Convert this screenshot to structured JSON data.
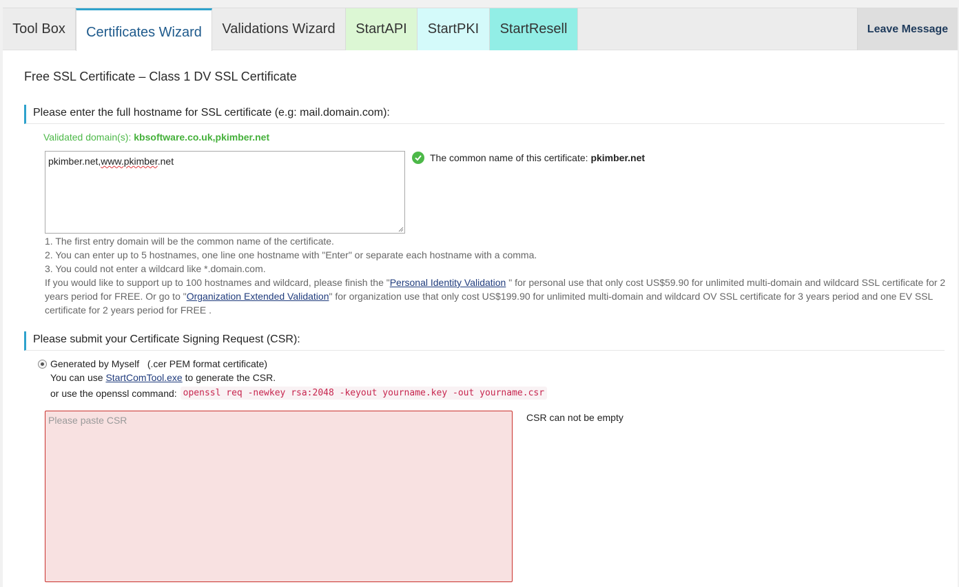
{
  "tabs": [
    {
      "label": "Tool Box"
    },
    {
      "label": "Certificates Wizard"
    },
    {
      "label": "Validations Wizard"
    },
    {
      "label": "StartAPI"
    },
    {
      "label": "StartPKI"
    },
    {
      "label": "StartResell"
    }
  ],
  "leave_message": "Leave Message",
  "page_title": "Free SSL Certificate – Class 1 DV SSL Certificate",
  "hostname_section": {
    "heading": "Please enter the full hostname for SSL certificate (e.g: mail.domain.com):",
    "validated_label": "Validated domain(s):",
    "validated_domains": "kbsoftware.co.uk,pkimber.net",
    "hostnames_part1": "pkimber.net,",
    "hostnames_part2": "www.pkimber",
    "hostnames_part3": ".net",
    "common_name_label": "The common name of this certificate:",
    "common_name_value": "pkimber.net",
    "note1": "1. The first entry domain will be the common name of the certificate.",
    "note2": "2. You can enter up to 5 hostnames, one line one hostname with \"Enter\" or separate each hostname with a comma.",
    "note3": "3. You could not enter a wildcard like *.domain.com.",
    "note4_a": "If you would like to support up to 100 hostnames and wildcard, please finish the \"",
    "note4_link1": "Personal Identity Validation",
    "note4_b": " \" for personal use that only cost US$59.90 for unlimited multi-domain and wildcard SSL certificate for 2 years period for FREE. Or go to \"",
    "note4_link2": "Organization Extended Validation",
    "note4_c": "\" for organization use that only cost US$199.90 for unlimited multi-domain and wildcard OV SSL certificate for 3 years period and one EV SSL certificate for 2 years period for FREE ."
  },
  "csr_section": {
    "heading": "Please submit your Certificate Signing Request (CSR):",
    "radio_label": "Generated by Myself",
    "radio_hint": "(.cer PEM format certificate)",
    "tool_prefix": "You can use ",
    "tool_link": "StartComTool.exe",
    "tool_suffix": " to generate the CSR.",
    "openssl_prefix": "or use the openssl command:",
    "openssl_command": "openssl req -newkey rsa:2048 -keyout yourname.key -out yourname.csr",
    "csr_placeholder": "Please paste CSR",
    "csr_error": "CSR can not be empty"
  }
}
